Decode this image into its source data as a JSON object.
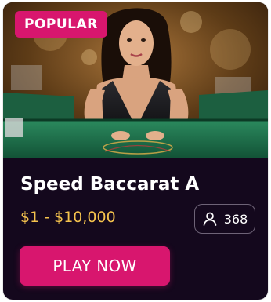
{
  "card": {
    "badge": "POPULAR",
    "title": "Speed Baccarat A",
    "limits": "$1 - $10,000",
    "player_count": "368",
    "cta_label": "PLAY NOW"
  },
  "icons": {
    "players": "user-icon"
  },
  "colors": {
    "accent": "#d8166e",
    "card_background": "#14081d",
    "limits_text": "#f4c24d",
    "table_felt": "#1e6b4a"
  }
}
